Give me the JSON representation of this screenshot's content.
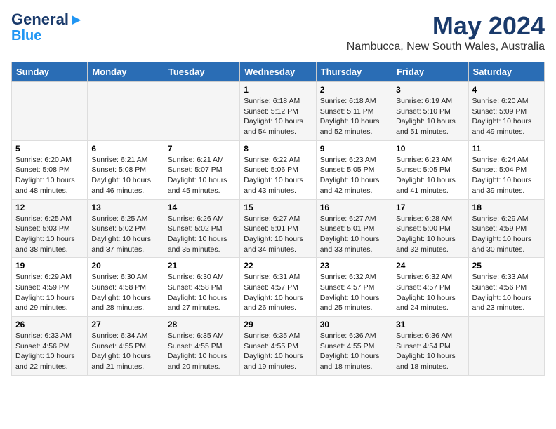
{
  "logo": {
    "line1": "General",
    "line2": "Blue"
  },
  "title": "May 2024",
  "subtitle": "Nambucca, New South Wales, Australia",
  "weekdays": [
    "Sunday",
    "Monday",
    "Tuesday",
    "Wednesday",
    "Thursday",
    "Friday",
    "Saturday"
  ],
  "weeks": [
    [
      {
        "num": "",
        "info": ""
      },
      {
        "num": "",
        "info": ""
      },
      {
        "num": "",
        "info": ""
      },
      {
        "num": "1",
        "info": "Sunrise: 6:18 AM\nSunset: 5:12 PM\nDaylight: 10 hours\nand 54 minutes."
      },
      {
        "num": "2",
        "info": "Sunrise: 6:18 AM\nSunset: 5:11 PM\nDaylight: 10 hours\nand 52 minutes."
      },
      {
        "num": "3",
        "info": "Sunrise: 6:19 AM\nSunset: 5:10 PM\nDaylight: 10 hours\nand 51 minutes."
      },
      {
        "num": "4",
        "info": "Sunrise: 6:20 AM\nSunset: 5:09 PM\nDaylight: 10 hours\nand 49 minutes."
      }
    ],
    [
      {
        "num": "5",
        "info": "Sunrise: 6:20 AM\nSunset: 5:08 PM\nDaylight: 10 hours\nand 48 minutes."
      },
      {
        "num": "6",
        "info": "Sunrise: 6:21 AM\nSunset: 5:08 PM\nDaylight: 10 hours\nand 46 minutes."
      },
      {
        "num": "7",
        "info": "Sunrise: 6:21 AM\nSunset: 5:07 PM\nDaylight: 10 hours\nand 45 minutes."
      },
      {
        "num": "8",
        "info": "Sunrise: 6:22 AM\nSunset: 5:06 PM\nDaylight: 10 hours\nand 43 minutes."
      },
      {
        "num": "9",
        "info": "Sunrise: 6:23 AM\nSunset: 5:05 PM\nDaylight: 10 hours\nand 42 minutes."
      },
      {
        "num": "10",
        "info": "Sunrise: 6:23 AM\nSunset: 5:05 PM\nDaylight: 10 hours\nand 41 minutes."
      },
      {
        "num": "11",
        "info": "Sunrise: 6:24 AM\nSunset: 5:04 PM\nDaylight: 10 hours\nand 39 minutes."
      }
    ],
    [
      {
        "num": "12",
        "info": "Sunrise: 6:25 AM\nSunset: 5:03 PM\nDaylight: 10 hours\nand 38 minutes."
      },
      {
        "num": "13",
        "info": "Sunrise: 6:25 AM\nSunset: 5:02 PM\nDaylight: 10 hours\nand 37 minutes."
      },
      {
        "num": "14",
        "info": "Sunrise: 6:26 AM\nSunset: 5:02 PM\nDaylight: 10 hours\nand 35 minutes."
      },
      {
        "num": "15",
        "info": "Sunrise: 6:27 AM\nSunset: 5:01 PM\nDaylight: 10 hours\nand 34 minutes."
      },
      {
        "num": "16",
        "info": "Sunrise: 6:27 AM\nSunset: 5:01 PM\nDaylight: 10 hours\nand 33 minutes."
      },
      {
        "num": "17",
        "info": "Sunrise: 6:28 AM\nSunset: 5:00 PM\nDaylight: 10 hours\nand 32 minutes."
      },
      {
        "num": "18",
        "info": "Sunrise: 6:29 AM\nSunset: 4:59 PM\nDaylight: 10 hours\nand 30 minutes."
      }
    ],
    [
      {
        "num": "19",
        "info": "Sunrise: 6:29 AM\nSunset: 4:59 PM\nDaylight: 10 hours\nand 29 minutes."
      },
      {
        "num": "20",
        "info": "Sunrise: 6:30 AM\nSunset: 4:58 PM\nDaylight: 10 hours\nand 28 minutes."
      },
      {
        "num": "21",
        "info": "Sunrise: 6:30 AM\nSunset: 4:58 PM\nDaylight: 10 hours\nand 27 minutes."
      },
      {
        "num": "22",
        "info": "Sunrise: 6:31 AM\nSunset: 4:57 PM\nDaylight: 10 hours\nand 26 minutes."
      },
      {
        "num": "23",
        "info": "Sunrise: 6:32 AM\nSunset: 4:57 PM\nDaylight: 10 hours\nand 25 minutes."
      },
      {
        "num": "24",
        "info": "Sunrise: 6:32 AM\nSunset: 4:57 PM\nDaylight: 10 hours\nand 24 minutes."
      },
      {
        "num": "25",
        "info": "Sunrise: 6:33 AM\nSunset: 4:56 PM\nDaylight: 10 hours\nand 23 minutes."
      }
    ],
    [
      {
        "num": "26",
        "info": "Sunrise: 6:33 AM\nSunset: 4:56 PM\nDaylight: 10 hours\nand 22 minutes."
      },
      {
        "num": "27",
        "info": "Sunrise: 6:34 AM\nSunset: 4:55 PM\nDaylight: 10 hours\nand 21 minutes."
      },
      {
        "num": "28",
        "info": "Sunrise: 6:35 AM\nSunset: 4:55 PM\nDaylight: 10 hours\nand 20 minutes."
      },
      {
        "num": "29",
        "info": "Sunrise: 6:35 AM\nSunset: 4:55 PM\nDaylight: 10 hours\nand 19 minutes."
      },
      {
        "num": "30",
        "info": "Sunrise: 6:36 AM\nSunset: 4:55 PM\nDaylight: 10 hours\nand 18 minutes."
      },
      {
        "num": "31",
        "info": "Sunrise: 6:36 AM\nSunset: 4:54 PM\nDaylight: 10 hours\nand 18 minutes."
      },
      {
        "num": "",
        "info": ""
      }
    ]
  ]
}
